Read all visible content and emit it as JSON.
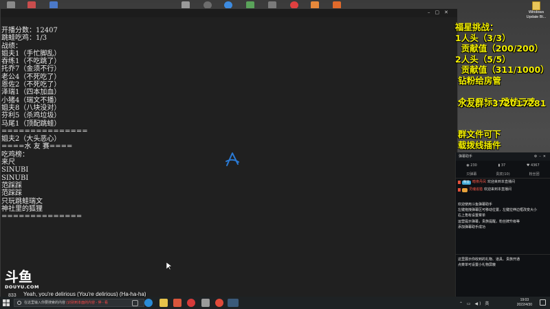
{
  "desktop": {
    "corner_file_label": "Windows\nUpdate Bl..."
  },
  "console": {
    "text": "开播分数：12407\n跳蛙吃鸡：1/3\n战绩：\n姐夫1（手忙脚乱）\n吞练1（不吃跳了）\n托乔7（金须不行）\n老公4（不死吃了）\n恩佐2（不死吃了）\n泽瑞1（四本加血）\n小猪4（瑞文不播）\n姐夫8（八块没对）\n芬利5（杀鸡垃圾）\n马尾1（顶配跳蛙）\n===============\n姐夫2（大头恶心）\n====水 友 赛====\n吃鸡榜：\n来尺\nSINUBI\nSINUBI\n范踩踩\n范踩踩\n只玩跳蛙瑞文\n神社里的狐狸\n=============="
  },
  "overlay": {
    "challenge_text": "福星挑战：\n1人头（3/3）\n  贡献值（200/200）\n2人头（5/5）\n  贡献值（311/1000）\n 钻粉给房管\n\n 今日目标：跳蛙三鸡",
    "fans_group": "水友群：372017281",
    "group_lines": "群文件可下\n载拨线插件"
  },
  "danmu_panel": {
    "title": "弹幕助手",
    "stats": [
      "230",
      "37",
      "4367"
    ],
    "tabs": [
      "只弹幕",
      "贵宾(10)",
      "粉丝团"
    ],
    "rows": [
      {
        "badge": "粉丝",
        "user": "暗夜丹凤",
        "msg": "欢迎来到本直播间"
      },
      {
        "badge": "",
        "user": "灵魂追猎",
        "msg": "欢迎来到本直播间"
      }
    ],
    "info": "欢迎使用斗鱼弹幕助手\n左键拖拽弹幕区可移动位置，左键拉伸边框改变大小\n右上角有设置菜单\n运营提示弹幕，贵族提醒，粉丝牌升级等\n添加弹幕助手成功",
    "footer": "这里展示你收到的礼物、道具、贵族开通\n点菜单可设置小礼物屏蔽"
  },
  "stream": {
    "logo_word": "DOUYU.COM",
    "logo_mark": "斗鱼",
    "lyric": "Yeah, you're delirious (You're delirious) (Ha-ha-ha)",
    "lyric_num": "833"
  },
  "taskbar": {
    "search_placeholder": "在这里输入你要搜索的内容",
    "search_red": "(识别到本面的内容 - 停 - 看",
    "time": "19:03",
    "date": "2022/4/30"
  },
  "colors": {
    "overlay_yellow": "#f4f000",
    "console_bg": "#202020",
    "accent_blue": "#2a7ad4"
  }
}
